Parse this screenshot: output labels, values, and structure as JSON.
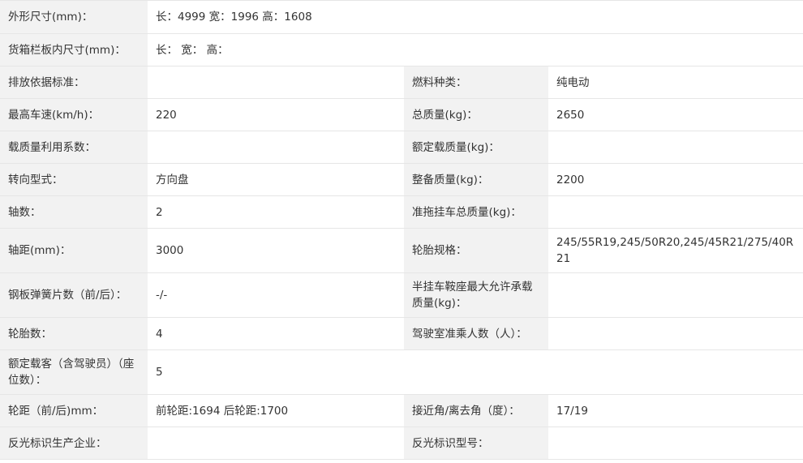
{
  "rows": [
    {
      "label": "外形尺寸(mm)：",
      "value": "长：4999 宽：1996 高：1608"
    },
    {
      "label": "货箱栏板内尺寸(mm)：",
      "value": "长：  宽：  高："
    },
    {
      "label": "排放依据标准：",
      "value": "",
      "label2": "燃料种类：",
      "value2": "纯电动"
    },
    {
      "label": "最高车速(km/h)：",
      "value": "220",
      "label2": "总质量(kg)：",
      "value2": "2650"
    },
    {
      "label": "载质量利用系数：",
      "value": "",
      "label2": "额定载质量(kg)：",
      "value2": ""
    },
    {
      "label": "转向型式：",
      "value": "方向盘",
      "label2": "整备质量(kg)：",
      "value2": "2200"
    },
    {
      "label": "轴数：",
      "value": "2",
      "label2": "准拖挂车总质量(kg)：",
      "value2": ""
    },
    {
      "label": "轴距(mm)：",
      "value": "3000",
      "label2": "轮胎规格：",
      "value2": "245/55R19,245/50R20,245/45R21/275/40R21"
    },
    {
      "label": "钢板弹簧片数（前/后）：",
      "value": "-/-",
      "label2": "半挂车鞍座最大允许承载质量(kg)：",
      "value2": ""
    },
    {
      "label": "轮胎数：",
      "value": "4",
      "label2": "驾驶室准乘人数（人）：",
      "value2": ""
    },
    {
      "label": "额定载客（含驾驶员）（座位数）：",
      "value": "5"
    },
    {
      "label": "轮距（前/后)mm：",
      "value": "前轮距:1694 后轮距:1700",
      "label2": "接近角/离去角（度）：",
      "value2": "17/19"
    },
    {
      "label": "反光标识生产企业：",
      "value": "",
      "label2": "反光标识型号：",
      "value2": ""
    }
  ]
}
